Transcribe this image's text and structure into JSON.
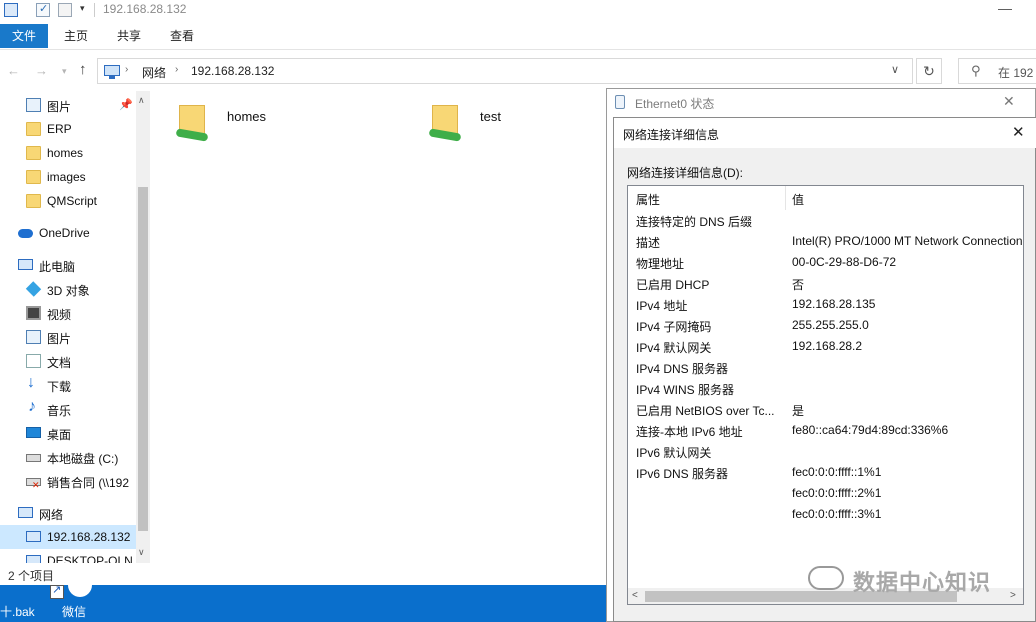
{
  "explorer": {
    "window_title": "192.168.28.132",
    "ribbon_tabs": {
      "file": "文件",
      "home": "主页",
      "share": "共享",
      "view": "查看"
    },
    "address": {
      "network": "网络",
      "host": "192.168.28.132"
    },
    "search_placeholder": "在 192"
  },
  "sidebar": {
    "items": [
      {
        "label": "图片",
        "icon": "pictures-icon"
      },
      {
        "label": "ERP",
        "icon": "folder-icon"
      },
      {
        "label": "homes",
        "icon": "folder-icon"
      },
      {
        "label": "images",
        "icon": "folder-icon"
      },
      {
        "label": "QMScript",
        "icon": "folder-icon"
      },
      {
        "label": "OneDrive",
        "icon": "onedrive-icon"
      },
      {
        "label": "此电脑",
        "icon": "this-pc-icon"
      },
      {
        "label": "3D 对象",
        "icon": "3d-objects-icon"
      },
      {
        "label": "视频",
        "icon": "video-icon"
      },
      {
        "label": "图片",
        "icon": "pictures-icon"
      },
      {
        "label": "文档",
        "icon": "documents-icon"
      },
      {
        "label": "下载",
        "icon": "downloads-icon"
      },
      {
        "label": "音乐",
        "icon": "music-icon"
      },
      {
        "label": "桌面",
        "icon": "desktop-icon"
      },
      {
        "label": "本地磁盘 (C:)",
        "icon": "local-disk-icon"
      },
      {
        "label": "销售合同 (\\\\192",
        "icon": "network-drive-icon"
      },
      {
        "label": "网络",
        "icon": "network-icon"
      },
      {
        "label": "192.168.28.132",
        "icon": "computer-icon"
      },
      {
        "label": "DESKTOP-OLN",
        "icon": "computer-icon"
      }
    ]
  },
  "content": {
    "shares": [
      {
        "name": "homes"
      },
      {
        "name": "test"
      }
    ]
  },
  "status_bar": {
    "text": "2 个项目"
  },
  "desktop": {
    "icon_bak_label": "十.bak",
    "icon_wechat_label": "微信"
  },
  "eth_dialog": {
    "title": "Ethernet0 状态"
  },
  "detail_dialog": {
    "title": "网络连接详细信息",
    "list_label": "网络连接详细信息(D):",
    "col_property": "属性",
    "col_value": "值",
    "rows": [
      {
        "k": "连接特定的 DNS 后缀",
        "v": ""
      },
      {
        "k": "描述",
        "v": "Intel(R) PRO/1000 MT Network Connection"
      },
      {
        "k": "物理地址",
        "v": "00-0C-29-88-D6-72"
      },
      {
        "k": "已启用 DHCP",
        "v": "否"
      },
      {
        "k": "IPv4 地址",
        "v": "192.168.28.135"
      },
      {
        "k": "IPv4 子网掩码",
        "v": "255.255.255.0"
      },
      {
        "k": "IPv4 默认网关",
        "v": "192.168.28.2"
      },
      {
        "k": "IPv4 DNS 服务器",
        "v": ""
      },
      {
        "k": "IPv4 WINS 服务器",
        "v": ""
      },
      {
        "k": "已启用 NetBIOS over Tc...",
        "v": "是"
      },
      {
        "k": "连接-本地 IPv6 地址",
        "v": "fe80::ca64:79d4:89cd:336%6"
      },
      {
        "k": "IPv6 默认网关",
        "v": ""
      },
      {
        "k": "IPv6 DNS 服务器",
        "v": "fec0:0:0:ffff::1%1"
      },
      {
        "k": "",
        "v": "fec0:0:0:ffff::2%1"
      },
      {
        "k": "",
        "v": "fec0:0:0:ffff::3%1"
      }
    ]
  },
  "watermark": {
    "text": "数据中心知识"
  }
}
